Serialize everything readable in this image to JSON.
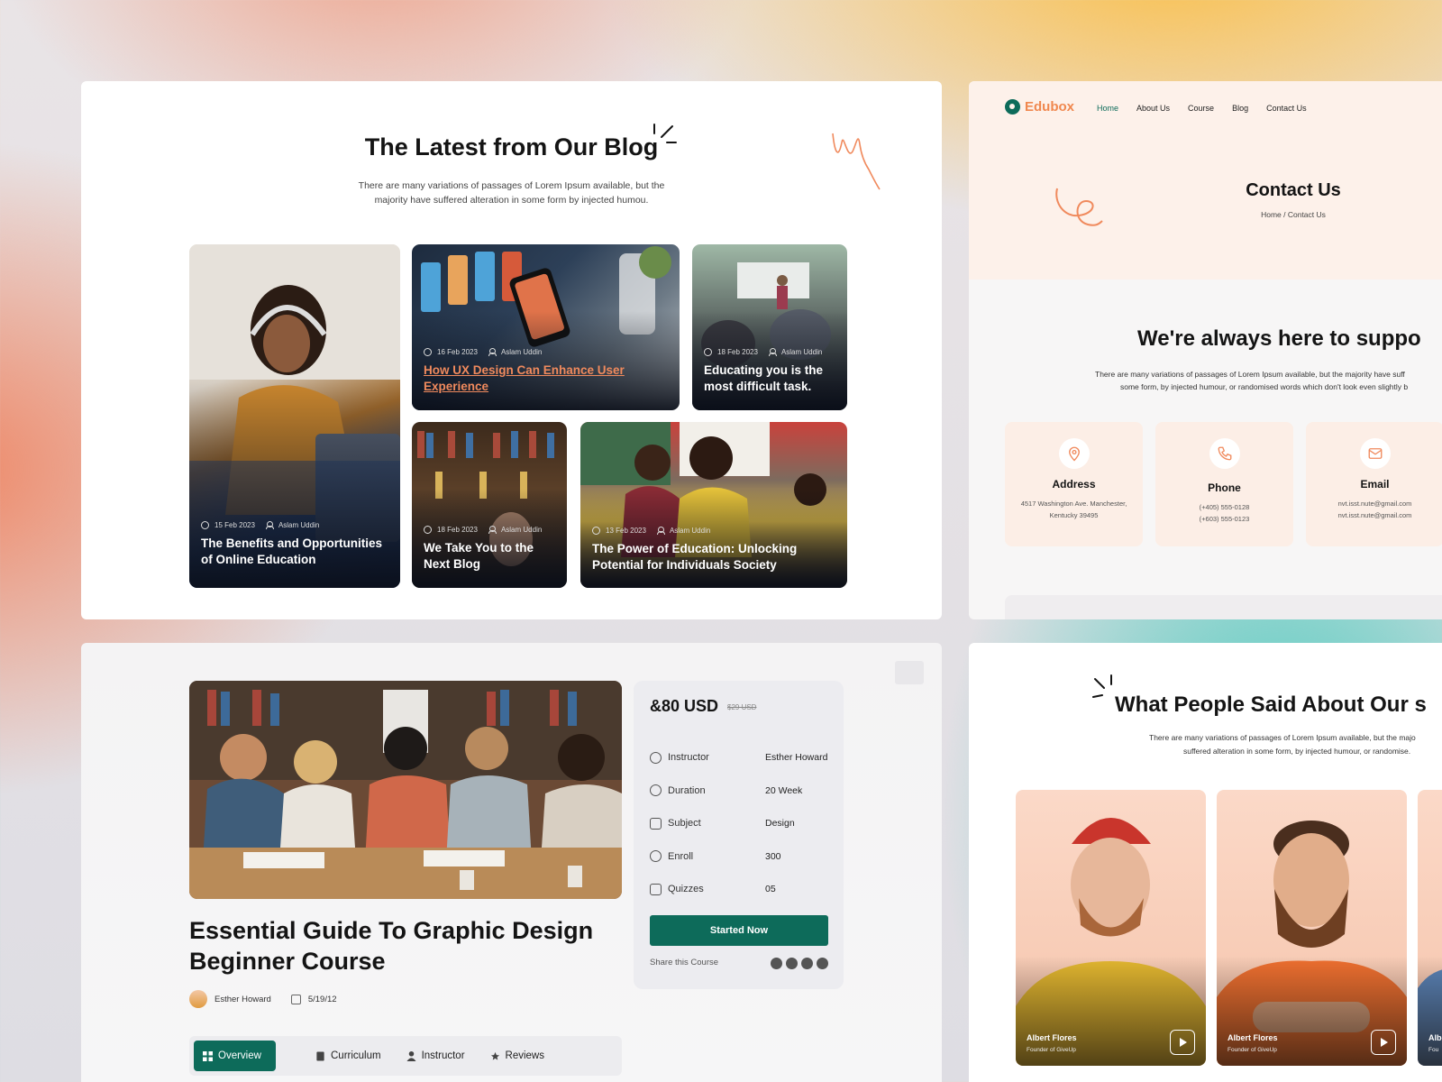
{
  "blog": {
    "title": "The Latest from Our Blog",
    "subtitle": "There are many variations of passages of Lorem Ipsum available, but the majority have suffered alteration in some form by injected humou.",
    "cards": [
      {
        "date": "15 Feb 2023",
        "author": "Aslam Uddin",
        "title": "The Benefits and Opportunities of Online Education"
      },
      {
        "date": "16 Feb 2023",
        "author": "Aslam Uddin",
        "title": "How UX Design Can Enhance User Experience"
      },
      {
        "date": "18 Feb 2023",
        "author": "Aslam Uddin",
        "title": "Educating you is the most difficult task."
      },
      {
        "date": "18 Feb 2023",
        "author": "Aslam Uddin",
        "title": "We Take You to the Next Blog"
      },
      {
        "date": "13 Feb 2023",
        "author": "Aslam Uddin",
        "title": "The Power of Education: Unlocking Potential for Individuals Society"
      }
    ]
  },
  "contact": {
    "logo": "Edubox",
    "nav": [
      "Home",
      "About Us",
      "Course",
      "Blog",
      "Contact Us"
    ],
    "title": "Contact Us",
    "breadcrumb": "Home / Contact Us",
    "heading": "We're always here to suppo",
    "para_line1": "There are many variations of passages of Lorem Ipsum available, but the majority have suff",
    "para_line2": "some form, by injected humour, or randomised words which don't look even slightly b",
    "cards": [
      {
        "label": "Address",
        "value": "4517 Washington Ave. Manchester,\nKentucky 39495",
        "icon": "map-pin-icon"
      },
      {
        "label": "Phone",
        "value": "(+405) 555-0128\n(+603) 555-0123",
        "icon": "phone-icon"
      },
      {
        "label": "Email",
        "value": "nvt.isst.nute@gmail.com\nnvt.isst.nute@gmail.com",
        "icon": "mail-icon"
      }
    ]
  },
  "course": {
    "title": "Essential Guide To Graphic Design Beginner Course",
    "author": "Esther Howard",
    "date": "5/19/12",
    "price": "&80 USD",
    "old_price": "$29 USD",
    "details": [
      {
        "label": "Instructor",
        "value": "Esther Howard",
        "icon": "user-icon"
      },
      {
        "label": "Duration",
        "value": "20 Week",
        "icon": "clock-icon"
      },
      {
        "label": "Subject",
        "value": "Design",
        "icon": "books-icon"
      },
      {
        "label": "Enroll",
        "value": "300",
        "icon": "users-icon"
      },
      {
        "label": "Quizzes",
        "value": "05",
        "icon": "monitor-icon"
      }
    ],
    "cta": "Started Now",
    "share_label": "Share this Course",
    "tabs": [
      "Overview",
      "Curriculum",
      "Instructor",
      "Reviews"
    ]
  },
  "testimonials": {
    "heading": "What People Said About Our s",
    "para_line1": "There are many variations of passages of Lorem Ipsum available, but the majo",
    "para_line2": "suffered alteration in some form, by injected humour, or randomise.",
    "people": [
      {
        "name": "Albert Flores",
        "role": "Founder of GiveUp"
      },
      {
        "name": "Albert Flores",
        "role": "Founder of GiveUp"
      },
      {
        "name": "Albe",
        "role": "Fou"
      }
    ]
  },
  "colors": {
    "accent": "#0d6b5a",
    "brand": "#f0884f"
  }
}
